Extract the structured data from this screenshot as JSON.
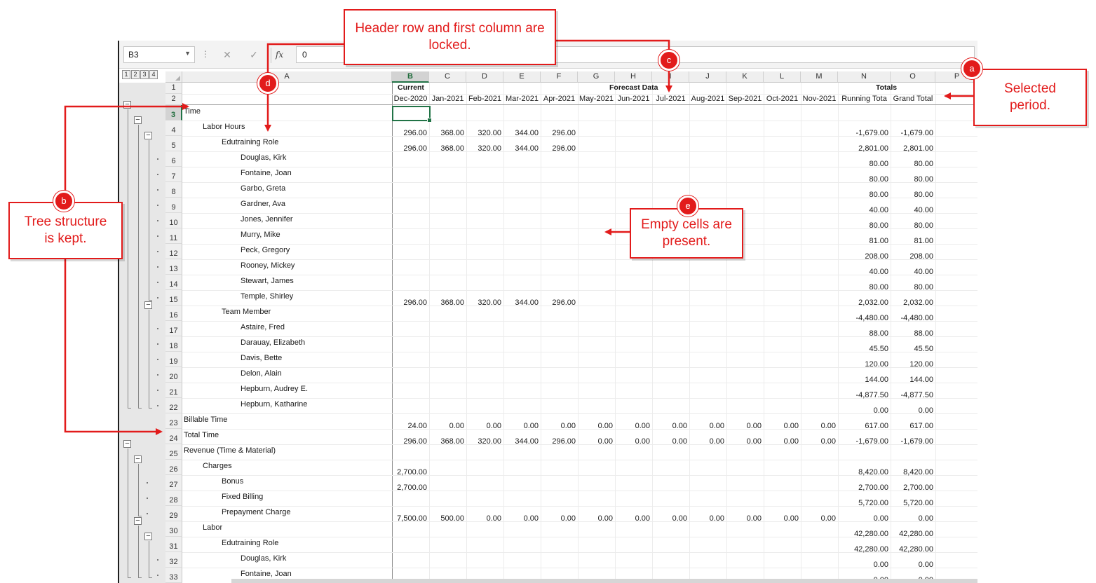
{
  "formula_bar": {
    "cell_ref": "B3",
    "value": "0",
    "fx": "fx",
    "cancel": "✕",
    "enter": "✓"
  },
  "outline_levels": [
    "1",
    "2",
    "3",
    "4"
  ],
  "columns": [
    "A",
    "B",
    "C",
    "D",
    "E",
    "F",
    "G",
    "H",
    "I",
    "J",
    "K",
    "L",
    "M",
    "N",
    "O",
    "P"
  ],
  "header_row1": {
    "current": "Current",
    "forecast": "Forecast Data",
    "totals": "Totals"
  },
  "header_row2": [
    "Dec-2020",
    "Jan-2021",
    "Feb-2021",
    "Mar-2021",
    "Apr-2021",
    "May-2021",
    "Jun-2021",
    "Jul-2021",
    "Aug-2021",
    "Sep-2021",
    "Oct-2021",
    "Nov-2021",
    "Running Tota",
    "Grand Total"
  ],
  "rows": [
    {
      "n": "3",
      "label": "Time",
      "indent": 0,
      "vals": [
        "",
        "",
        "",
        "",
        "",
        "",
        "",
        "",
        "",
        "",
        "",
        "",
        "",
        ""
      ]
    },
    {
      "n": "4",
      "label": "Labor Hours",
      "indent": 1,
      "vals": [
        "296.00",
        "368.00",
        "320.00",
        "344.00",
        "296.00",
        "",
        "",
        "",
        "",
        "",
        "",
        "",
        "-1,679.00",
        "-1,679.00"
      ]
    },
    {
      "n": "5",
      "label": "Edutraining Role",
      "indent": 2,
      "vals": [
        "296.00",
        "368.00",
        "320.00",
        "344.00",
        "296.00",
        "",
        "",
        "",
        "",
        "",
        "",
        "",
        "2,801.00",
        "2,801.00"
      ]
    },
    {
      "n": "6",
      "label": "Douglas, Kirk",
      "indent": 3,
      "vals": [
        "",
        "",
        "",
        "",
        "",
        "",
        "",
        "",
        "",
        "",
        "",
        "",
        "80.00",
        "80.00"
      ]
    },
    {
      "n": "7",
      "label": "Fontaine, Joan",
      "indent": 3,
      "vals": [
        "",
        "",
        "",
        "",
        "",
        "",
        "",
        "",
        "",
        "",
        "",
        "",
        "80.00",
        "80.00"
      ]
    },
    {
      "n": "8",
      "label": "Garbo, Greta",
      "indent": 3,
      "vals": [
        "",
        "",
        "",
        "",
        "",
        "",
        "",
        "",
        "",
        "",
        "",
        "",
        "80.00",
        "80.00"
      ]
    },
    {
      "n": "9",
      "label": "Gardner, Ava",
      "indent": 3,
      "vals": [
        "",
        "",
        "",
        "",
        "",
        "",
        "",
        "",
        "",
        "",
        "",
        "",
        "40.00",
        "40.00"
      ]
    },
    {
      "n": "10",
      "label": "Jones, Jennifer",
      "indent": 3,
      "vals": [
        "",
        "",
        "",
        "",
        "",
        "",
        "",
        "",
        "",
        "",
        "",
        "",
        "80.00",
        "80.00"
      ]
    },
    {
      "n": "11",
      "label": "Murry, Mike",
      "indent": 3,
      "vals": [
        "",
        "",
        "",
        "",
        "",
        "",
        "",
        "",
        "",
        "",
        "",
        "",
        "81.00",
        "81.00"
      ]
    },
    {
      "n": "12",
      "label": "Peck, Gregory",
      "indent": 3,
      "vals": [
        "",
        "",
        "",
        "",
        "",
        "",
        "",
        "",
        "",
        "",
        "",
        "",
        "208.00",
        "208.00"
      ]
    },
    {
      "n": "13",
      "label": "Rooney, Mickey",
      "indent": 3,
      "vals": [
        "",
        "",
        "",
        "",
        "",
        "",
        "",
        "",
        "",
        "",
        "",
        "",
        "40.00",
        "40.00"
      ]
    },
    {
      "n": "14",
      "label": "Stewart, James",
      "indent": 3,
      "vals": [
        "",
        "",
        "",
        "",
        "",
        "",
        "",
        "",
        "",
        "",
        "",
        "",
        "80.00",
        "80.00"
      ]
    },
    {
      "n": "15",
      "label": "Temple, Shirley",
      "indent": 3,
      "vals": [
        "296.00",
        "368.00",
        "320.00",
        "344.00",
        "296.00",
        "",
        "",
        "",
        "",
        "",
        "",
        "",
        "2,032.00",
        "2,032.00"
      ]
    },
    {
      "n": "16",
      "label": "Team Member",
      "indent": 2,
      "vals": [
        "",
        "",
        "",
        "",
        "",
        "",
        "",
        "",
        "",
        "",
        "",
        "",
        "-4,480.00",
        "-4,480.00"
      ]
    },
    {
      "n": "17",
      "label": "Astaire, Fred",
      "indent": 3,
      "vals": [
        "",
        "",
        "",
        "",
        "",
        "",
        "",
        "",
        "",
        "",
        "",
        "",
        "88.00",
        "88.00"
      ]
    },
    {
      "n": "18",
      "label": "Darauay, Elizabeth",
      "indent": 3,
      "vals": [
        "",
        "",
        "",
        "",
        "",
        "",
        "",
        "",
        "",
        "",
        "",
        "",
        "45.50",
        "45.50"
      ]
    },
    {
      "n": "19",
      "label": "Davis, Bette",
      "indent": 3,
      "vals": [
        "",
        "",
        "",
        "",
        "",
        "",
        "",
        "",
        "",
        "",
        "",
        "",
        "120.00",
        "120.00"
      ]
    },
    {
      "n": "20",
      "label": "Delon, Alain",
      "indent": 3,
      "vals": [
        "",
        "",
        "",
        "",
        "",
        "",
        "",
        "",
        "",
        "",
        "",
        "",
        "144.00",
        "144.00"
      ]
    },
    {
      "n": "21",
      "label": "Hepburn, Audrey E.",
      "indent": 3,
      "vals": [
        "",
        "",
        "",
        "",
        "",
        "",
        "",
        "",
        "",
        "",
        "",
        "",
        "-4,877.50",
        "-4,877.50"
      ]
    },
    {
      "n": "22",
      "label": "Hepburn, Katharine",
      "indent": 3,
      "vals": [
        "",
        "",
        "",
        "",
        "",
        "",
        "",
        "",
        "",
        "",
        "",
        "",
        "0.00",
        "0.00"
      ]
    },
    {
      "n": "23",
      "label": "Billable Time",
      "indent": 0,
      "vals": [
        "24.00",
        "0.00",
        "0.00",
        "0.00",
        "0.00",
        "0.00",
        "0.00",
        "0.00",
        "0.00",
        "0.00",
        "0.00",
        "0.00",
        "617.00",
        "617.00"
      ]
    },
    {
      "n": "24",
      "label": "Total Time",
      "indent": 0,
      "vals": [
        "296.00",
        "368.00",
        "320.00",
        "344.00",
        "296.00",
        "0.00",
        "0.00",
        "0.00",
        "0.00",
        "0.00",
        "0.00",
        "0.00",
        "-1,679.00",
        "-1,679.00"
      ]
    },
    {
      "n": "25",
      "label": "Revenue (Time & Material)",
      "indent": 0,
      "vals": [
        "",
        "",
        "",
        "",
        "",
        "",
        "",
        "",
        "",
        "",
        "",
        "",
        "",
        ""
      ]
    },
    {
      "n": "26",
      "label": "Charges",
      "indent": 1,
      "vals": [
        "2,700.00",
        "",
        "",
        "",
        "",
        "",
        "",
        "",
        "",
        "",
        "",
        "",
        "8,420.00",
        "8,420.00"
      ]
    },
    {
      "n": "27",
      "label": "Bonus",
      "indent": 2,
      "vals": [
        "2,700.00",
        "",
        "",
        "",
        "",
        "",
        "",
        "",
        "",
        "",
        "",
        "",
        "2,700.00",
        "2,700.00"
      ]
    },
    {
      "n": "28",
      "label": "Fixed Billing",
      "indent": 2,
      "vals": [
        "",
        "",
        "",
        "",
        "",
        "",
        "",
        "",
        "",
        "",
        "",
        "",
        "5,720.00",
        "5,720.00"
      ]
    },
    {
      "n": "29",
      "label": "Prepayment Charge",
      "indent": 2,
      "vals": [
        "7,500.00",
        "500.00",
        "0.00",
        "0.00",
        "0.00",
        "0.00",
        "0.00",
        "0.00",
        "0.00",
        "0.00",
        "0.00",
        "0.00",
        "0.00",
        "0.00"
      ]
    },
    {
      "n": "30",
      "label": "Labor",
      "indent": 1,
      "vals": [
        "",
        "",
        "",
        "",
        "",
        "",
        "",
        "",
        "",
        "",
        "",
        "",
        "42,280.00",
        "42,280.00"
      ]
    },
    {
      "n": "31",
      "label": "Edutraining Role",
      "indent": 2,
      "vals": [
        "",
        "",
        "",
        "",
        "",
        "",
        "",
        "",
        "",
        "",
        "",
        "",
        "42,280.00",
        "42,280.00"
      ]
    },
    {
      "n": "32",
      "label": "Douglas, Kirk",
      "indent": 3,
      "vals": [
        "",
        "",
        "",
        "",
        "",
        "",
        "",
        "",
        "",
        "",
        "",
        "",
        "0.00",
        "0.00"
      ]
    },
    {
      "n": "33",
      "label": "Fontaine, Joan",
      "indent": 3,
      "vals": [
        "",
        "",
        "",
        "",
        "",
        "",
        "",
        "",
        "",
        "",
        "",
        "",
        "0.00",
        "0.00"
      ]
    }
  ],
  "annotations": {
    "header_locked": "Header row and first column are locked.",
    "selected_period": "Selected period.",
    "tree_structure": "Tree structure is kept.",
    "empty_cells": "Empty cells are present.",
    "badge_a": "a",
    "badge_b": "b",
    "badge_c": "c",
    "badge_d": "d",
    "badge_e": "e"
  },
  "colors": {
    "callout_red": "#e21b1b",
    "excel_green": "#217346"
  }
}
